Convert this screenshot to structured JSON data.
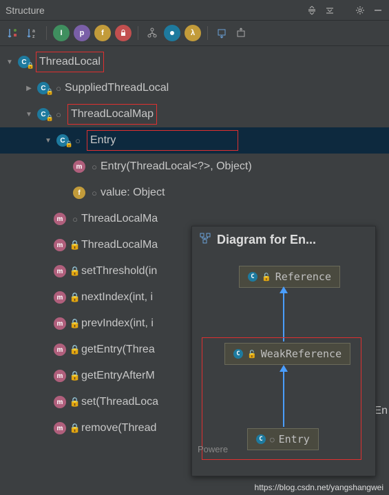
{
  "header": {
    "title": "Structure"
  },
  "tree": {
    "root": {
      "label": "ThreadLocal",
      "children": [
        {
          "label": "SuppliedThreadLocal",
          "kind": "class",
          "expanded": false,
          "overlay": true
        },
        {
          "label": "ThreadLocalMap",
          "kind": "class",
          "expanded": true,
          "overlay": true,
          "redbox": true,
          "children": [
            {
              "label": "Entry",
              "kind": "class",
              "expanded": true,
              "overlay": true,
              "selected": true,
              "redbox": true,
              "children": [
                {
                  "label": "Entry(ThreadLocal<?>, Object)",
                  "kind": "method",
                  "vis": "open"
                },
                {
                  "label": "value: Object",
                  "kind": "field",
                  "vis": "open"
                }
              ]
            },
            {
              "label": "ThreadLocalMa",
              "kind": "method",
              "vis": "open",
              "overlay": true
            },
            {
              "label": "ThreadLocalMa",
              "kind": "method",
              "vis": "locked",
              "overlay": true
            },
            {
              "label": "setThreshold(in",
              "kind": "method",
              "vis": "locked"
            },
            {
              "label": "nextIndex(int, i",
              "kind": "method",
              "vis": "locked",
              "overlay": true
            },
            {
              "label": "prevIndex(int, i",
              "kind": "method",
              "vis": "locked",
              "overlay": true
            },
            {
              "label": "getEntry(Threa",
              "kind": "method",
              "vis": "locked"
            },
            {
              "label": "getEntryAfterM",
              "kind": "method",
              "vis": "locked"
            },
            {
              "label": "set(ThreadLoca",
              "kind": "method",
              "vis": "locked",
              "overlay": true
            },
            {
              "label": "remove(Thread",
              "kind": "method",
              "vis": "locked"
            }
          ]
        }
      ]
    }
  },
  "diagram": {
    "title": "Diagram for En...",
    "nodes": {
      "ref": "Reference",
      "weak": "WeakReference",
      "entry": "Entry"
    },
    "powered": "Powere",
    "truncated": "En"
  },
  "watermark": "https://blog.csdn.net/yangshangwei"
}
